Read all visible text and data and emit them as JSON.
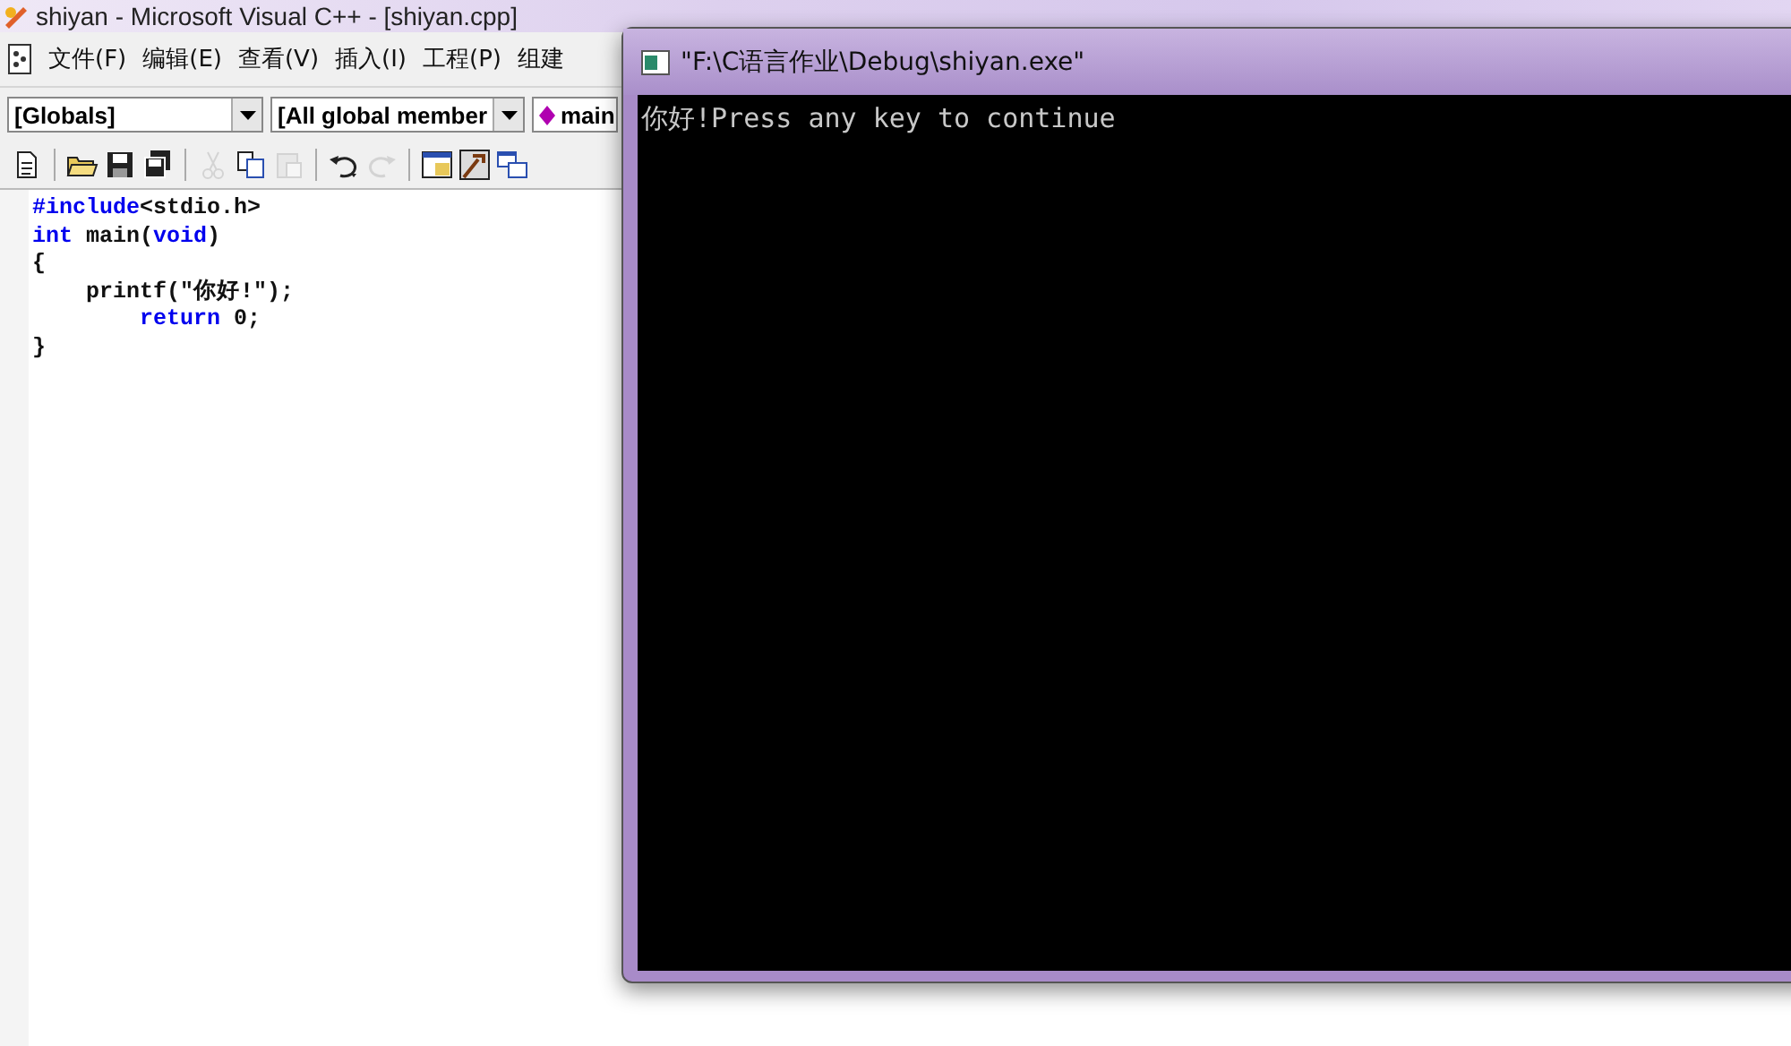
{
  "ide_window": {
    "title": "shiyan - Microsoft Visual C++ - [shiyan.cpp]",
    "menu": [
      "文件(F)",
      "编辑(E)",
      "查看(V)",
      "插入(I)",
      "工程(P)",
      "组建"
    ],
    "combos": [
      {
        "value": "[Globals]",
        "kind": "plain"
      },
      {
        "value": "[All global member",
        "kind": "plain"
      },
      {
        "value": "main",
        "kind": "function"
      }
    ],
    "toolbar": [
      {
        "kind": "new",
        "disabled": false
      },
      {
        "kind": "sep"
      },
      {
        "kind": "open",
        "disabled": false
      },
      {
        "kind": "save",
        "disabled": false
      },
      {
        "kind": "saveall",
        "disabled": false
      },
      {
        "kind": "sep"
      },
      {
        "kind": "cut",
        "disabled": true
      },
      {
        "kind": "copy",
        "disabled": false
      },
      {
        "kind": "paste",
        "disabled": true
      },
      {
        "kind": "sep"
      },
      {
        "kind": "undo",
        "disabled": false
      },
      {
        "kind": "redo",
        "disabled": true
      },
      {
        "kind": "sep"
      },
      {
        "kind": "workspace",
        "disabled": false
      },
      {
        "kind": "output",
        "disabled": false
      },
      {
        "kind": "windows",
        "disabled": false
      }
    ],
    "code": [
      [
        {
          "kind": "keyword",
          "text": "#include"
        },
        {
          "kind": "plain",
          "text": "<stdio.h>"
        }
      ],
      [
        {
          "kind": "keyword",
          "text": "int"
        },
        {
          "kind": "plain",
          "text": " main("
        },
        {
          "kind": "keyword",
          "text": "void"
        },
        {
          "kind": "plain",
          "text": ")"
        }
      ],
      [
        {
          "kind": "plain",
          "text": "{"
        }
      ],
      [
        {
          "kind": "plain",
          "text": "    printf(\"你好!\");"
        }
      ],
      [
        {
          "kind": "keyword",
          "text": "        return"
        },
        {
          "kind": "plain",
          "text": " 0;"
        }
      ],
      [
        {
          "kind": "plain",
          "text": "}"
        }
      ]
    ]
  },
  "console_window": {
    "title": "\"F:\\C语言作业\\Debug\\shiyan.exe\"",
    "output": "你好!Press any key to continue"
  }
}
